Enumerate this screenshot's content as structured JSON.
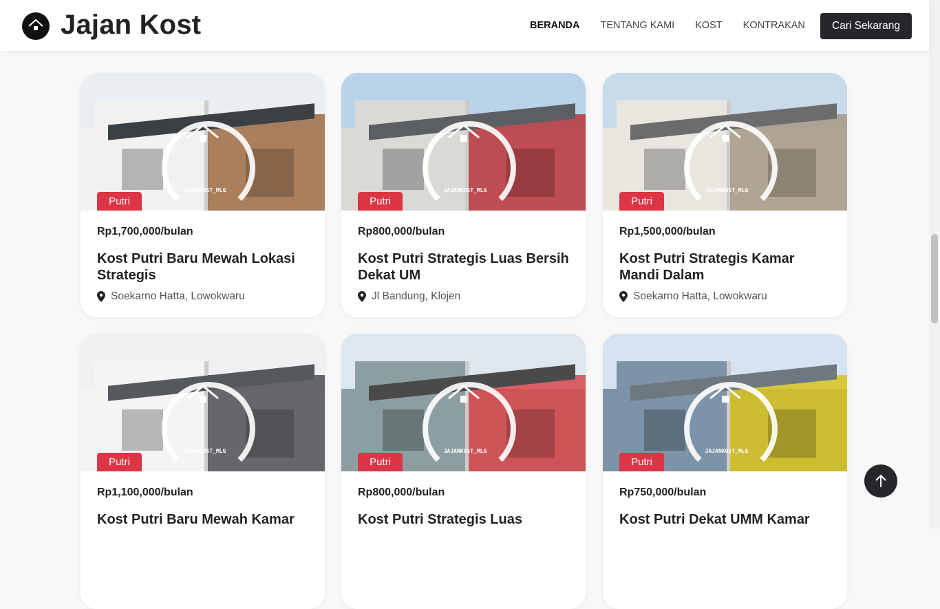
{
  "brand": {
    "name": "Jajan Kost",
    "logo_icon": "house-logo-icon"
  },
  "nav": {
    "items": [
      "BERANDA",
      "TENTANG KAMI",
      "KOST",
      "KONTRAKAN"
    ],
    "active": "BERANDA",
    "cta_label": "Cari Sekarang"
  },
  "watermark": "JAJANKOST_MLG",
  "listings": [
    {
      "badge": "Putri",
      "price": "Rp1,700,000/bulan",
      "title": "Kost Putri Baru Mewah Lokasi Strategis",
      "location": "Soekarno Hatta, Lowokwaru",
      "palette": {
        "sky": "#e9eef3",
        "wall": "#f1f1ef",
        "accent": "#9c6b43",
        "roof": "#3b4045"
      }
    },
    {
      "badge": "Putri",
      "price": "Rp800,000/bulan",
      "title": "Kost Putri Strategis Luas Bersih Dekat UM",
      "location": "Jl Bandung, Klojen",
      "palette": {
        "sky": "#b9d3ea",
        "wall": "#d9d9d6",
        "accent": "#b7343b",
        "roof": "#5b5f61"
      }
    },
    {
      "badge": "Putri",
      "price": "Rp1,500,000/bulan",
      "title": "Kost Putri Strategis Kamar Mandi Dalam",
      "location": "Soekarno Hatta, Lowokwaru",
      "palette": {
        "sky": "#c9dbe9",
        "wall": "#e9e6e0",
        "accent": "#a69884",
        "roof": "#6c6c6c"
      }
    },
    {
      "badge": "Putri",
      "price": "Rp1,100,000/bulan",
      "title": "Kost Putri Baru Mewah Kamar",
      "location": "",
      "palette": {
        "sky": "#eef0f2",
        "wall": "#f4f4f4",
        "accent": "#4b4d52",
        "roof": "#55585c"
      }
    },
    {
      "badge": "Putri",
      "price": "Rp800,000/bulan",
      "title": "Kost Putri Strategis Luas",
      "location": "",
      "palette": {
        "sky": "#dfe7ee",
        "wall": "#8d9ea1",
        "accent": "#d9464b",
        "roof": "#4a4a4a"
      }
    },
    {
      "badge": "Putri",
      "price": "Rp750,000/bulan",
      "title": "Kost Putri Dekat UMM Kamar",
      "location": "",
      "palette": {
        "sky": "#d6e3f0",
        "wall": "#7c93a8",
        "accent": "#d9c31b",
        "roof": "#6e7880"
      }
    }
  ],
  "icons": {
    "location": "map-pin-icon",
    "scroll_top": "arrow-up-icon"
  },
  "colors": {
    "badge": "#dc3545",
    "dark": "#25272b",
    "card_bg": "#ffffff",
    "page_bg": "#f8f8f8"
  }
}
